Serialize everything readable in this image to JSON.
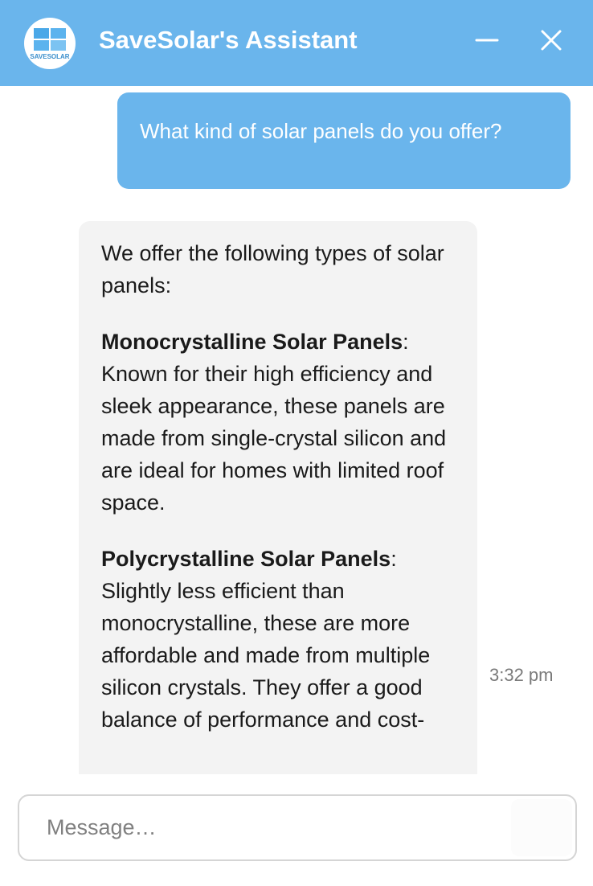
{
  "header": {
    "title": "SaveSolar's Assistant",
    "logo_text": "SAVESOLAR",
    "minimize_icon": "minimize-icon",
    "close_icon": "close-icon",
    "background": "#6ab5ec"
  },
  "messages": {
    "user": {
      "text": "What kind of solar panels do you offer?"
    },
    "bot": {
      "intro": "We offer the following types of solar panels:",
      "items": [
        {
          "heading": "Monocrystalline Solar Panels",
          "text": "Known for their high efficiency and sleek appearance, these panels are made from single-crystal silicon and are ideal for homes with limited roof space."
        },
        {
          "heading": "Polycrystalline Solar Panels",
          "text": "Slightly less efficient than monocrystalline, these are more affordable and made from multiple silicon crystals. They offer a good balance of performance and cost-"
        }
      ],
      "timestamp": "3:32 pm"
    }
  },
  "composer": {
    "placeholder": "Message…"
  }
}
